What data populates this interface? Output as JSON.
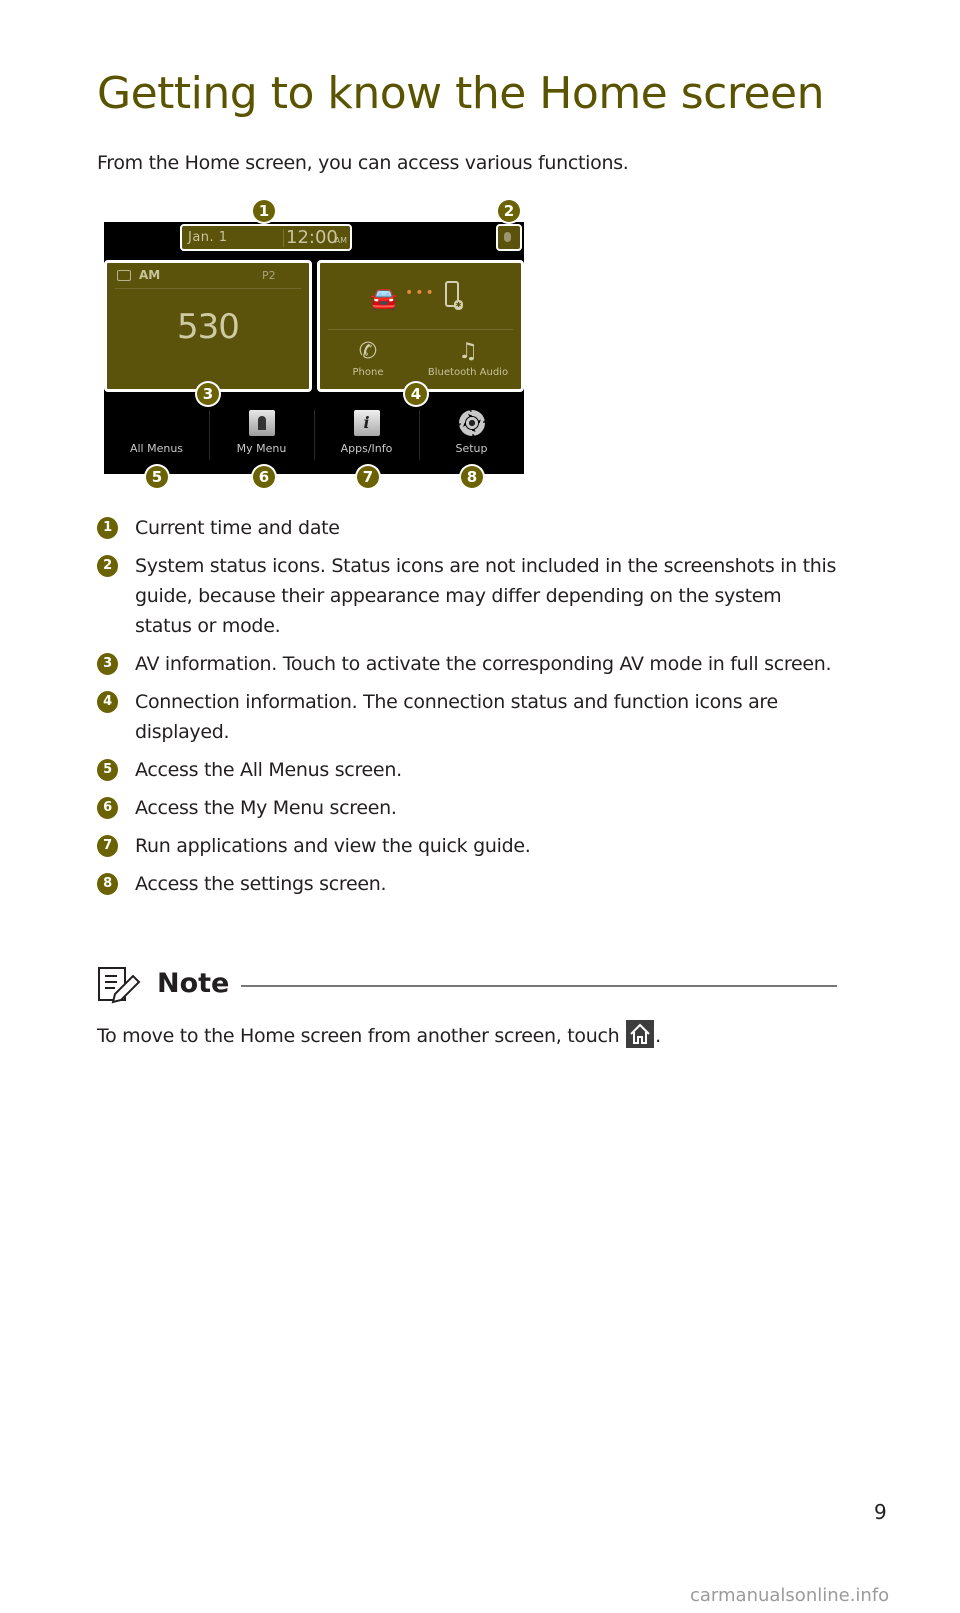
{
  "page": {
    "title": "Getting to know the Home screen",
    "intro": "From the Home screen, you can access various functions.",
    "page_number": "9",
    "watermark": "carmanualsonline.info"
  },
  "screen": {
    "date": "Jan.  1",
    "time": "12:00",
    "ampm": "AM",
    "av": {
      "band": "AM",
      "preset": "P2",
      "frequency": "530"
    },
    "connection": {
      "functions": [
        {
          "label": "Phone",
          "icon": "phone-icon"
        },
        {
          "label": "Bluetooth Audio",
          "icon": "bluetooth-audio-icon"
        }
      ]
    },
    "bottom_menu": [
      {
        "label": "All Menus",
        "icon": "grid-icon"
      },
      {
        "label": "My Menu",
        "icon": "folder-user-icon"
      },
      {
        "label": "Apps/Info",
        "icon": "info-icon"
      },
      {
        "label": "Setup",
        "icon": "gear-icon"
      }
    ],
    "badges": [
      "1",
      "2",
      "3",
      "4",
      "5",
      "6",
      "7",
      "8"
    ]
  },
  "callouts": [
    {
      "num": "1",
      "text": "Current time and date"
    },
    {
      "num": "2",
      "text": "System status icons. Status icons are not included in the screenshots in this guide, because their appearance may differ depending on the system status or mode."
    },
    {
      "num": "3",
      "text": "AV information. Touch to activate the corresponding AV mode in full screen."
    },
    {
      "num": "4",
      "text": "Connection information. The connection status and function icons are displayed."
    },
    {
      "num": "5",
      "text": "Access the All Menus screen."
    },
    {
      "num": "6",
      "text": "Access the My Menu screen."
    },
    {
      "num": "7",
      "text": "Run applications and view the quick guide."
    },
    {
      "num": "8",
      "text": "Access the settings screen."
    }
  ],
  "note": {
    "label": "Note",
    "text_before": "To move to the Home screen from another screen, touch ",
    "text_after": ".",
    "icon": "home-icon"
  },
  "colors": {
    "accent": "#5a5400",
    "badge": "#6b6203",
    "panel": "#5b520c"
  }
}
